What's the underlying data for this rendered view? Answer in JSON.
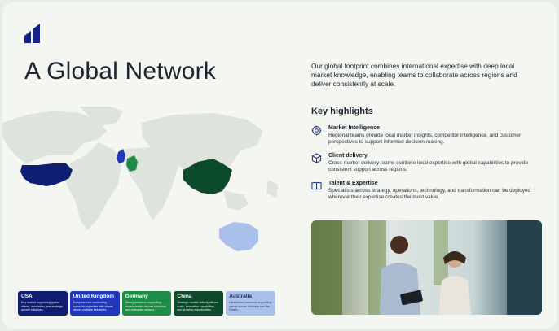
{
  "page": {
    "title": "A Global Network",
    "intro": "Our global footprint combines international expertise with deep local market knowledge, enabling teams to collaborate across regions and deliver consistently at scale."
  },
  "highlights": {
    "heading": "Key highlights",
    "items": [
      {
        "title": "Market Intelligence",
        "text": "Regional teams provide local market insights, competitor intelligence, and customer perspectives to support informed decision-making.",
        "icon": "settings-gear-icon"
      },
      {
        "title": "Client delivery",
        "text": "Cross-market delivery teams combine local expertise with global capabilities to provide consistent support across regions.",
        "icon": "cube-box-icon"
      },
      {
        "title": "Talent & Expertise",
        "text": "Specialists across strategy, operations, technology, and transformation can be deployed wherever their expertise creates the most value.",
        "icon": "open-book-icon"
      }
    ]
  },
  "countries": [
    {
      "name": "USA",
      "desc": "Key market supporting global clients, innovation, and strategic growth initiatives.",
      "color": "#0f1d73"
    },
    {
      "name": "United Kingdom",
      "desc": "European hub connecting specialist expertise with clients across multiple industries.",
      "color": "#1f37b8"
    },
    {
      "name": "Germany",
      "desc": "Strong presence supporting transformation across industrial and enterprise sectors.",
      "color": "#1f8d47"
    },
    {
      "name": "China",
      "desc": "Strategic market with significant scale, innovation capabilities, and growing opportunities.",
      "color": "#0b4a2a"
    },
    {
      "name": "Australia",
      "desc": "Established presence supporting clients across Australia and the Pacific.",
      "color": "#a9c0ea"
    }
  ],
  "colors": {
    "background": "#f3f6f1",
    "map_land": "#dfe3dd",
    "usa": "#0f1d73",
    "uk": "#1f37b8",
    "germany": "#1f8d47",
    "china": "#0b4a2a",
    "australia": "#a9c0ea",
    "logo": "#14238a"
  }
}
